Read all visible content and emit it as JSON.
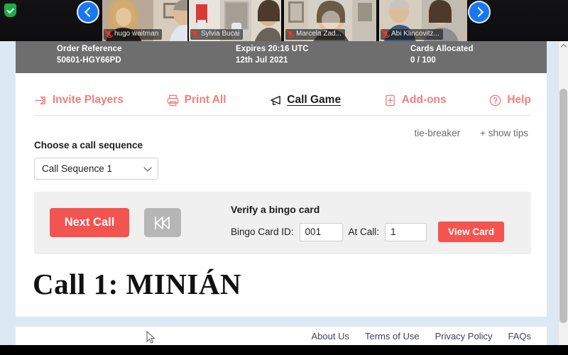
{
  "videoconference": {
    "prev_button": "previous-participants",
    "next_button": "next-participants",
    "participants": [
      {
        "name": "hugo waitman",
        "muted": true
      },
      {
        "name": "Sylvia Bucai",
        "muted": true
      },
      {
        "name": "Marcela Zad...",
        "muted": true
      },
      {
        "name": "Abi Klincovitz...",
        "muted": true
      }
    ]
  },
  "order_bar": {
    "columns": [
      {
        "label": "Order Reference",
        "value": "50601-HGY66PD"
      },
      {
        "label": "Expires 20:16 UTC",
        "value": "12th Jul 2021"
      },
      {
        "label": "Cards Allocated",
        "value": "0 / 100"
      }
    ]
  },
  "nav": {
    "items": [
      {
        "label": "Invite Players",
        "icon": "invite-arrow-icon",
        "active": false
      },
      {
        "label": "Print All",
        "icon": "printer-icon",
        "active": false
      },
      {
        "label": "Call Game",
        "icon": "megaphone-icon",
        "active": true
      },
      {
        "label": "Add-ons",
        "icon": "add-card-icon",
        "active": false
      },
      {
        "label": "Help",
        "icon": "question-circle-icon",
        "active": false
      }
    ]
  },
  "tips": {
    "tie_breaker": "tie-breaker",
    "show_tips": "+ show tips"
  },
  "sequence": {
    "label": "Choose a call sequence",
    "selected": "Call Sequence 1",
    "options": [
      "Call Sequence 1"
    ]
  },
  "controls": {
    "next_call": "Next Call",
    "rewind_icon": "rewind-icon",
    "verify_title": "Verify a bingo card",
    "card_id_label": "Bingo Card ID:",
    "card_id_value": "001",
    "at_call_label": "At Call:",
    "at_call_value": "1",
    "view_card": "View Card"
  },
  "call_display": "Call 1: MINIÁN",
  "footer": {
    "links": [
      "About Us",
      "Terms of Use",
      "Privacy Policy",
      "FAQs"
    ]
  },
  "colors": {
    "accent_red": "#f4544f",
    "nav_red": "#ef7f7c",
    "order_bar_grey": "#6e6e6e",
    "panel_grey": "#f0f0f0",
    "page_blue": "#dce9f5",
    "zoom_blue": "#1877f2"
  }
}
